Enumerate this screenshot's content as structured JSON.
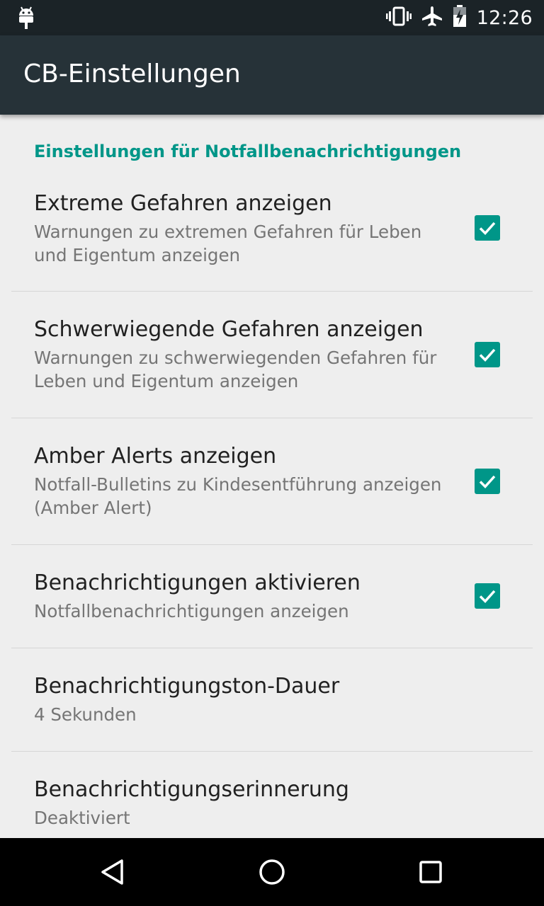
{
  "status_bar": {
    "time": "12:26",
    "icons": [
      "android-debug-icon",
      "vibrate-icon",
      "airplane-mode-icon",
      "battery-charging-icon"
    ]
  },
  "app_bar": {
    "title": "CB-Einstellungen"
  },
  "settings": {
    "category": "Einstellungen für Notfallbenachrichtigungen",
    "items": [
      {
        "title": "Extreme Gefahren anzeigen",
        "summary": "Warnungen zu extremen Gefahren für Leben und Eigentum anzeigen",
        "checked": true
      },
      {
        "title": "Schwerwiegende Gefahren anzeigen",
        "summary": "Warnungen zu schwerwiegenden Gefahren für Leben und Eigentum anzeigen",
        "checked": true
      },
      {
        "title": "Amber Alerts anzeigen",
        "summary": "Notfall-Bulletins zu Kindesentführung anzeigen (Amber Alert)",
        "checked": true
      },
      {
        "title": "Benachrichtigungen aktivieren",
        "summary": "Notfallbenachrichtigungen anzeigen",
        "checked": true
      },
      {
        "title": "Benachrichtigungston-Dauer",
        "summary": "4 Sekunden"
      },
      {
        "title": "Benachrichtigungserinnerung",
        "summary": "Deaktiviert"
      }
    ]
  },
  "nav_bar": {
    "buttons": [
      "back-icon",
      "home-icon",
      "recents-icon"
    ]
  },
  "colors": {
    "accent": "#009688",
    "app_bar": "#263238",
    "status_bar": "#1b2327",
    "background": "#eeeeee"
  }
}
